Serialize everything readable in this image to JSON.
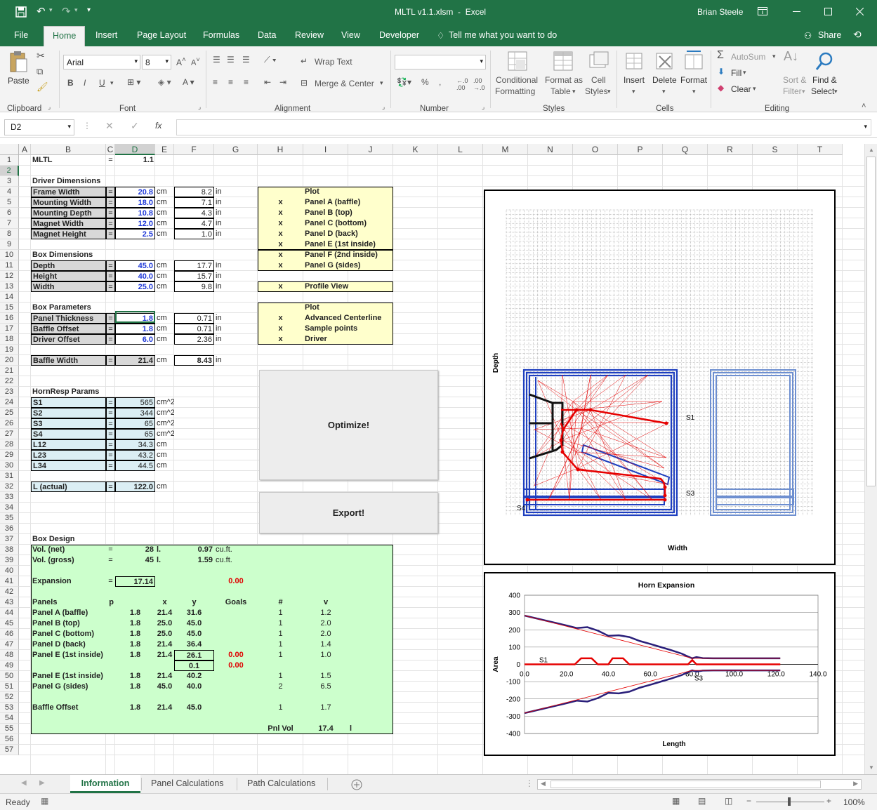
{
  "title": {
    "file": "MLTL v1.1.xlsm",
    "sep": "-",
    "app": "Excel",
    "user": "Brian Steele"
  },
  "tabs": [
    "File",
    "Home",
    "Insert",
    "Page Layout",
    "Formulas",
    "Data",
    "Review",
    "View",
    "Developer"
  ],
  "tell": "Tell me what you want to do",
  "share": "Share",
  "ribbon": {
    "paste": "Paste",
    "font": "Arial",
    "size": "8",
    "wrap": "Wrap Text",
    "merge": "Merge & Center",
    "cond1": "Conditional",
    "cond2": "Formatting",
    "fmt1": "Format as",
    "fmt2": "Table",
    "cs1": "Cell",
    "cs2": "Styles",
    "insert": "Insert",
    "delete": "Delete",
    "format": "Format",
    "autosum": "AutoSum",
    "fill": "Fill",
    "clear": "Clear",
    "sort1": "Sort &",
    "sort2": "Filter",
    "find1": "Find &",
    "find2": "Select",
    "bold": "B",
    "italic": "I",
    "underline": "U",
    "groups": {
      "clipboard": "Clipboard",
      "font": "Font",
      "alignment": "Alignment",
      "number": "Number",
      "styles": "Styles",
      "cells": "Cells",
      "editing": "Editing"
    }
  },
  "namebox": "D2",
  "fx": "fx",
  "columns": [
    "A",
    "B",
    "C",
    "D",
    "E",
    "F",
    "G",
    "H",
    "I",
    "J",
    "K",
    "L",
    "M",
    "N",
    "O",
    "P",
    "Q",
    "R",
    "S",
    "T"
  ],
  "rows": [
    "1",
    "2",
    "3",
    "4",
    "5",
    "6",
    "7",
    "8",
    "9",
    "10",
    "11",
    "12",
    "13",
    "14",
    "15",
    "16",
    "17",
    "18",
    "19",
    "20",
    "21",
    "22",
    "23",
    "24",
    "25",
    "26",
    "27",
    "28",
    "29",
    "30",
    "31",
    "32",
    "33",
    "34",
    "35",
    "36",
    "37",
    "38",
    "39",
    "40",
    "41",
    "42",
    "43",
    "44",
    "45",
    "46",
    "47",
    "48",
    "49",
    "50",
    "51",
    "52",
    "53",
    "54",
    "55",
    "56",
    "57"
  ],
  "c": {
    "mltl": "MLTL",
    "eq": "=",
    "ver": "1.1",
    "dd": "Driver Dimensions",
    "fw": "Frame Width",
    "mw": "Mounting Width",
    "md": "Mounting Depth",
    "magw": "Magnet Width",
    "magh": "Magnet Height",
    "v_fw": "20.8",
    "v_mw": "18.0",
    "v_md": "10.8",
    "v_magw": "12.0",
    "v_magh": "2.5",
    "in_fw": "8.2",
    "in_mw": "7.1",
    "in_md": "4.3",
    "in_magw": "4.7",
    "in_magh": "1.0",
    "cm": "cm",
    "in": "in",
    "bd": "Box Dimensions",
    "depth": "Depth",
    "height": "Height",
    "width": "Width",
    "v_depth": "45.0",
    "v_height": "40.0",
    "v_width": "25.0",
    "in_depth": "17.7",
    "in_height": "15.7",
    "in_width": "9.8",
    "bp": "Box Parameters",
    "pt": "Panel Thickness",
    "bo": "Baffle Offset",
    "do": "Driver Offset",
    "v_pt": "1.8",
    "v_bo": "1.8",
    "v_do": "6.0",
    "in_pt": "0.71",
    "in_bo": "0.71",
    "in_do": "2.36",
    "bw": "Baffle Width",
    "v_bw": "21.4",
    "in_bw": "8.43",
    "hrp": "HornResp Params",
    "s1": "S1",
    "s2": "S2",
    "s3": "S3",
    "s4": "S4",
    "l12": "L12",
    "l23": "L23",
    "l34": "L34",
    "v_s1": "565",
    "v_s2": "344",
    "v_s3": "65",
    "v_s4": "65",
    "cm2": "cm^2",
    "v_l12": "34.3",
    "v_l23": "43.2",
    "v_l34": "44.5",
    "lact": "L (actual)",
    "v_lact": "122.0",
    "plot": "Plot",
    "x": "x",
    "pa": "Panel A (baffle)",
    "pb": "Panel B (top)",
    "pc": "Panel C (bottom)",
    "pd": "Panel D (back)",
    "pe": "Panel E (1st inside)",
    "pf": "Panel F (2nd inside)",
    "pg": "Panel G (sides)",
    "pv": "Profile View",
    "acl": "Advanced Centerline",
    "sp": "Sample points",
    "drv": "Driver",
    "optimize": "Optimize!",
    "export": "Export!",
    "bxd": "Box Design",
    "vnet": "Vol. (net)",
    "vgross": "Vol. (gross)",
    "v_vnet": "28",
    "v_vgross": "45",
    "l": "l.",
    "cf1": "0.97",
    "cf2": "1.59",
    "cuft": "cu.ft.",
    "exp": "Expansion",
    "v_exp": "17.14",
    "zero": "0.00",
    "panels": "Panels",
    "hp": "p",
    "hx": "x",
    "hy": "y",
    "goals": "Goals",
    "hash": "#",
    "hv": "v",
    "pnlvol": "Pnl Vol",
    "v_pnlvol": "17.4",
    "lsmall": "l",
    "baffleoff": "Baffle Offset",
    "pe2": "Panel E (1st inside)"
  },
  "panels": [
    [
      "Panel A (baffle)",
      "1.8",
      "21.4",
      "31.6",
      "",
      "1",
      "1.2"
    ],
    [
      "Panel B (top)",
      "1.8",
      "25.0",
      "45.0",
      "",
      "1",
      "2.0"
    ],
    [
      "Panel C (bottom)",
      "1.8",
      "25.0",
      "45.0",
      "",
      "1",
      "2.0"
    ],
    [
      "Panel D (back)",
      "1.8",
      "21.4",
      "36.4",
      "",
      "1",
      "1.4"
    ],
    [
      "Panel E (1st inside)",
      "1.8",
      "21.4",
      "26.1",
      "0.00",
      "1",
      "1.0"
    ],
    [
      "",
      "",
      "",
      "0.1",
      "0.00",
      "",
      ""
    ],
    [
      "Panel E (1st inside)",
      "1.8",
      "21.4",
      "40.2",
      "",
      "1",
      "1.5"
    ],
    [
      "Panel G (sides)",
      "1.8",
      "45.0",
      "40.0",
      "",
      "2",
      "6.5"
    ]
  ],
  "baffle_row": [
    "Baffle Offset",
    "1.8",
    "21.4",
    "45.0",
    "1",
    "1.7"
  ],
  "sheet_tabs": [
    "Information",
    "Panel Calculations",
    "Path Calculations"
  ],
  "status": {
    "ready": "Ready",
    "zoom": "100%"
  },
  "chart_data": [
    {
      "type": "line",
      "title": "",
      "xlabel": "Width",
      "ylabel": "Depth",
      "annotations": [
        "S1",
        "S3",
        "S4"
      ]
    },
    {
      "type": "line",
      "title": "Horn Expansion",
      "xlabel": "Length",
      "ylabel": "Area",
      "xlim": [
        0,
        140
      ],
      "ylim": [
        -400,
        400
      ],
      "xticks": [
        "0.0",
        "20.0",
        "40.0",
        "60.0",
        "80.0",
        "100.0",
        "120.0",
        "140.0"
      ],
      "yticks": [
        "400",
        "300",
        "200",
        "100",
        "0",
        "-100",
        "-200",
        "-300",
        "-400"
      ],
      "annotations": [
        "S1",
        "S3"
      ],
      "series": [
        {
          "x": [
            0,
            20,
            25,
            30,
            35,
            40,
            45,
            50,
            55,
            60,
            65,
            70,
            75,
            78,
            80,
            82,
            85,
            90,
            100,
            110,
            122
          ],
          "y": [
            282,
            225,
            210,
            215,
            195,
            165,
            168,
            158,
            135,
            118,
            100,
            82,
            62,
            45,
            35,
            42,
            36,
            35,
            35,
            35,
            35
          ]
        },
        {
          "x": [
            0,
            80,
            122
          ],
          "y": [
            282,
            35,
            35
          ]
        },
        {
          "x": [
            0,
            20,
            25,
            30,
            35,
            40,
            45,
            50,
            55,
            60,
            65,
            70,
            75,
            78,
            80,
            82,
            85,
            90,
            100,
            110,
            122
          ],
          "y": [
            -282,
            -225,
            -210,
            -215,
            -195,
            -165,
            -168,
            -158,
            -135,
            -118,
            -100,
            -82,
            -62,
            -45,
            -35,
            -42,
            -36,
            -35,
            -35,
            -35,
            -35
          ]
        },
        {
          "x": [
            0,
            80,
            122
          ],
          "y": [
            -282,
            -35,
            -35
          ]
        },
        {
          "x": [
            0,
            24,
            27,
            32,
            35,
            40,
            42,
            47,
            50,
            78,
            80,
            82,
            122
          ],
          "y": [
            0,
            0,
            35,
            35,
            0,
            0,
            35,
            35,
            0,
            0,
            25,
            0,
            0
          ]
        }
      ]
    }
  ]
}
